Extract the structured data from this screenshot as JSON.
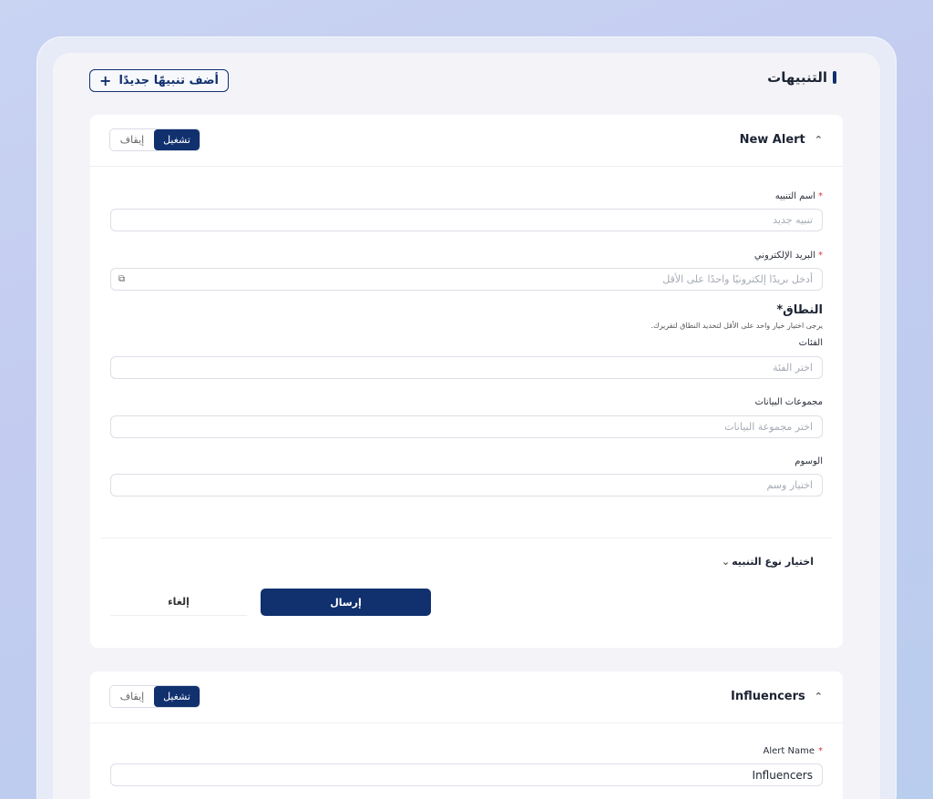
{
  "header": {
    "title": "التنبيهات",
    "add_button_label": "أضف تنبيهًا جديدًا",
    "add_icon": "+"
  },
  "alert1": {
    "title": "New Alert",
    "toggle_on": "تشغيل",
    "toggle_off": "إيقاف",
    "name_label": "اسم التنبيه",
    "name_placeholder": "تنبيه جديد",
    "email_label": "البريد الإلكتروني",
    "email_placeholder": "أدخل بريدًا إلكترونيًا واحدًا على الأقل",
    "scope_title": "النطاق*",
    "scope_hint": "يرجى اختيار خيار واحد على الأقل لتحديد النطاق لتقريرك.",
    "category_label": "الفئات",
    "category_placeholder": "اختر الفئة",
    "dataset_label": "مجموعات البيانات",
    "dataset_placeholder": "اختر مجموعة البيانات",
    "tags_label": "الوسوم",
    "tags_placeholder": "اختيار وسم",
    "alert_type_label": "اختيار نوع التنبيه",
    "submit_label": "إرسال",
    "cancel_label": "إلغاء"
  },
  "alert2": {
    "title": "Influencers",
    "toggle_on": "تشغيل",
    "toggle_off": "إيقاف",
    "name_label": "Alert Name",
    "name_value": "Influencers"
  },
  "required_mark": "*",
  "icons": {
    "chevron_up": "⌃",
    "chevron_down": "⌄",
    "copy": "⧉"
  },
  "colors": {
    "primary": "#10306e",
    "required": "#d13a3a"
  }
}
